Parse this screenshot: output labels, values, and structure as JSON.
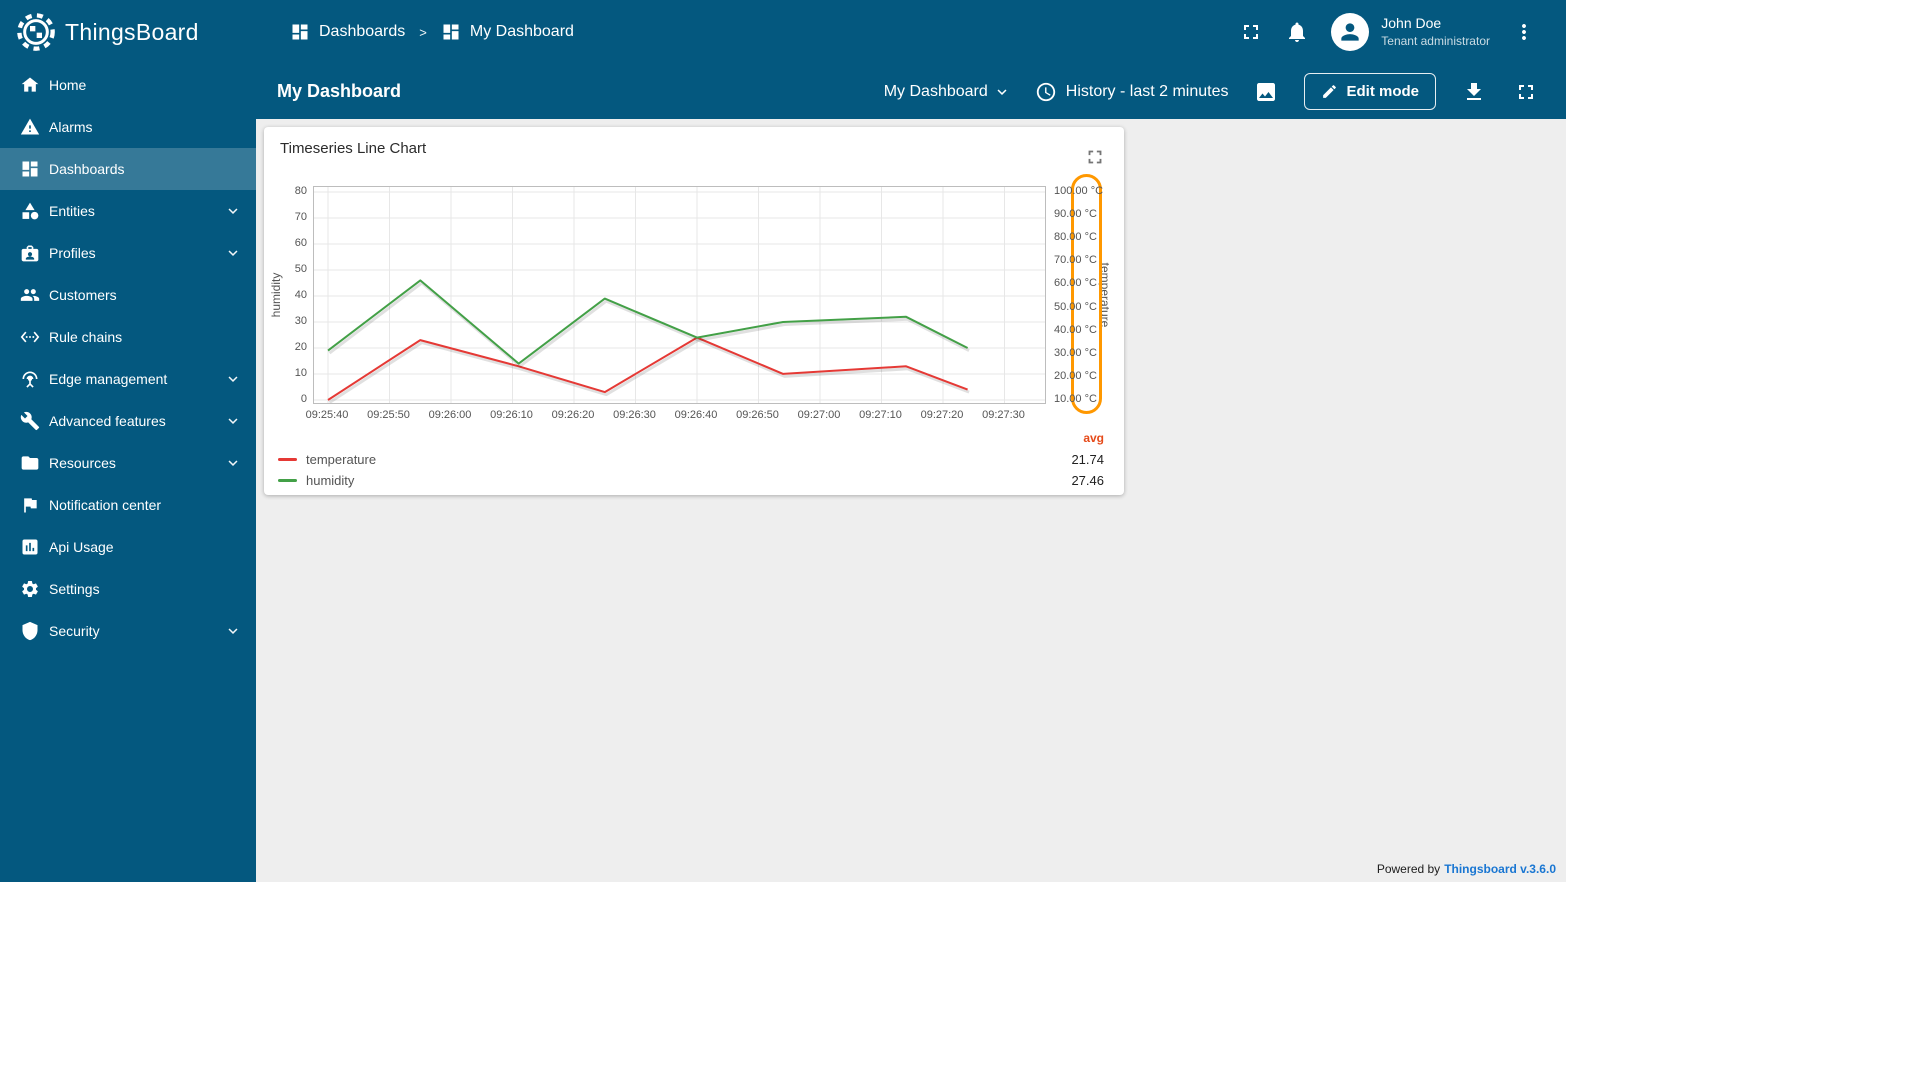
{
  "app": {
    "name": "ThingsBoard",
    "footer": {
      "powered_by": "Powered by",
      "version_link": "Thingsboard v.3.6.0"
    }
  },
  "colors": {
    "primary": "#04587f",
    "sidebar_active_overlay": "rgba(255,255,255,0.2)",
    "content_background": "#eeeeee",
    "annotation_orange": "#ff9800",
    "temperature_red": "#e53935",
    "humidity_green": "#43a047",
    "avg_header": "#e64a19",
    "footer_link_blue": "#1976d2"
  },
  "header": {
    "separator": ">",
    "breadcrumb": [
      {
        "label": "Dashboards",
        "icon": "dashboard"
      },
      {
        "label": "My Dashboard",
        "icon": "dashboard"
      }
    ],
    "user_name": "John Doe",
    "user_role": "Tenant administrator",
    "icons": [
      "fullscreen-icon",
      "bell-icon",
      "avatar-person-icon",
      "more-vert-icon"
    ]
  },
  "toolbar": {
    "title": "My Dashboard",
    "dashboard_select_value": "My Dashboard",
    "history_label": "History - last 2 minutes",
    "edit_mode_label": "Edit mode",
    "icons": [
      "clock-icon",
      "image-icon",
      "pencil-icon",
      "download-icon",
      "fullscreen-icon"
    ]
  },
  "sidebar": {
    "items": [
      {
        "label": "Home",
        "icon": "home",
        "active": false,
        "expandable": false
      },
      {
        "label": "Alarms",
        "icon": "warning",
        "active": false,
        "expandable": false
      },
      {
        "label": "Dashboards",
        "icon": "dashboard",
        "active": true,
        "expandable": false
      },
      {
        "label": "Entities",
        "icon": "entities",
        "active": false,
        "expandable": true
      },
      {
        "label": "Profiles",
        "icon": "profiles",
        "active": false,
        "expandable": true
      },
      {
        "label": "Customers",
        "icon": "customers",
        "active": false,
        "expandable": false
      },
      {
        "label": "Rule chains",
        "icon": "rule-chains",
        "active": false,
        "expandable": false
      },
      {
        "label": "Edge management",
        "icon": "edge-antenna",
        "active": false,
        "expandable": true
      },
      {
        "label": "Advanced features",
        "icon": "wrench",
        "active": false,
        "expandable": true
      },
      {
        "label": "Resources",
        "icon": "folder",
        "active": false,
        "expandable": true
      },
      {
        "label": "Notification center",
        "icon": "flag",
        "active": false,
        "expandable": false
      },
      {
        "label": "Api Usage",
        "icon": "chart-box",
        "active": false,
        "expandable": false
      },
      {
        "label": "Settings",
        "icon": "gear",
        "active": false,
        "expandable": false
      },
      {
        "label": "Security",
        "icon": "shield",
        "active": false,
        "expandable": true
      }
    ]
  },
  "widget": {
    "title": "Timeseries Line Chart",
    "legend_avg_label": "avg",
    "legend": [
      {
        "name": "temperature",
        "avg": "21.74",
        "color": "#e53935"
      },
      {
        "name": "humidity",
        "avg": "27.46",
        "color": "#43a047"
      }
    ]
  },
  "chart_data": {
    "type": "line",
    "title": "Timeseries Line Chart",
    "x_tick_labels": [
      "09:25:40",
      "09:25:50",
      "09:26:00",
      "09:26:10",
      "09:26:20",
      "09:26:30",
      "09:26:40",
      "09:26:50",
      "09:27:00",
      "09:27:10",
      "09:27:20",
      "09:27:30"
    ],
    "x_tick_interval_sec": 10,
    "left_axis": {
      "label": "humidity",
      "min": 0,
      "max": 80,
      "ticks": [
        0,
        10,
        20,
        30,
        40,
        50,
        60,
        70,
        80
      ]
    },
    "right_axis": {
      "label": "temperature",
      "min": 10,
      "max": 100,
      "ticks": [
        10,
        20,
        30,
        40,
        50,
        60,
        70,
        80,
        90,
        100
      ],
      "tick_suffix": " °C",
      "tick_decimals": 2
    },
    "grid": true,
    "legend_position": "bottom-left",
    "series": [
      {
        "name": "temperature",
        "axis": "right",
        "color": "#e53935",
        "avg": 21.74,
        "t_offsets_sec": [
          0,
          15,
          31,
          45,
          60,
          74,
          94,
          104
        ],
        "values": [
          10.0,
          35.9,
          24.6,
          13.4,
          37.0,
          21.3,
          24.6,
          14.5
        ]
      },
      {
        "name": "humidity",
        "axis": "left",
        "color": "#43a047",
        "avg": 27.46,
        "t_offsets_sec": [
          0,
          15,
          31,
          45,
          60,
          74,
          94,
          104
        ],
        "values": [
          19,
          46,
          14,
          39,
          24,
          30,
          32,
          20
        ]
      }
    ],
    "annotation": {
      "shape": "rounded-rect-highlight",
      "color": "#ff9800",
      "target": "right_axis_tick_labels"
    }
  }
}
